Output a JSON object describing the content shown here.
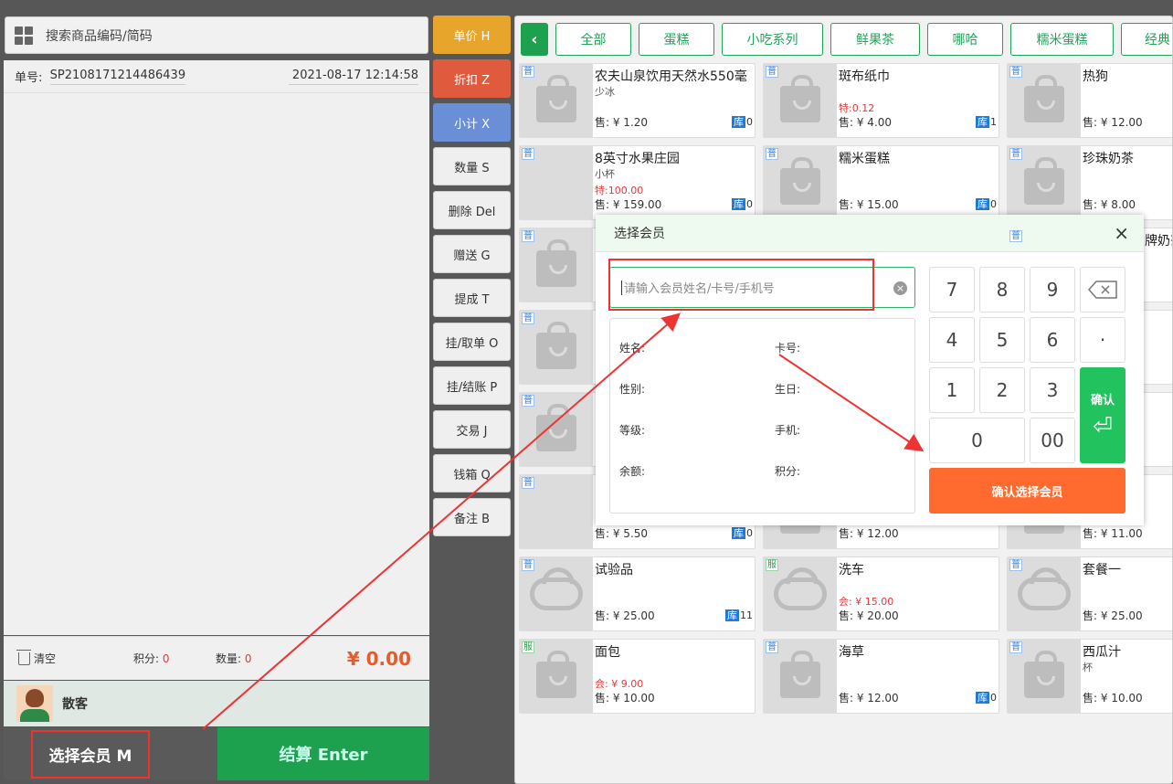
{
  "search": {
    "placeholder": "搜索商品编码/简码"
  },
  "order": {
    "no_label": "单号:",
    "no": "SP2108171214486439",
    "datetime": "2021-08-17 12:14:58"
  },
  "summary": {
    "clear": "清空",
    "points_label": "积分:",
    "points": "0",
    "qty_label": "数量:",
    "qty": "0",
    "total": "¥ 0.00"
  },
  "member": {
    "name": "散客"
  },
  "buttons": {
    "select_member": "选择会员 M",
    "checkout": "结算 Enter"
  },
  "functions": [
    "单价 H",
    "折扣 Z",
    "小计 X",
    "数量 S",
    "删除 Del",
    "赠送 G",
    "提成 T",
    "挂/取单 O",
    "挂/结账 P",
    "交易 J",
    "钱箱 Q",
    "备注 B"
  ],
  "categories": [
    "全部",
    "蛋糕",
    "小吃系列",
    "鲜果茶",
    "哪哈",
    "糯米蛋糕",
    "经典"
  ],
  "products": [
    {
      "tag": "普",
      "name": "农夫山泉饮用天然水550毫",
      "sub": "少冰",
      "spec": "",
      "price": "售: ¥ 1.20",
      "stock": "0"
    },
    {
      "tag": "普",
      "name": "斑布纸巾",
      "sub": "",
      "spec": "特:0.12",
      "price": "售: ¥ 4.00",
      "stock": "1"
    },
    {
      "tag": "普",
      "name": "热狗",
      "sub": "",
      "spec": "",
      "price": "售: ¥ 12.00",
      "stock": ""
    },
    {
      "tag": "普",
      "name": "8英寸水果庄园",
      "sub": "小杯",
      "spec": "特:100.00",
      "price": "售: ¥ 159.00",
      "stock": "0"
    },
    {
      "tag": "普",
      "name": "糯米蛋糕",
      "sub": "",
      "spec": "",
      "price": "售: ¥ 15.00",
      "stock": "0"
    },
    {
      "tag": "普",
      "name": "珍珠奶茶",
      "sub": "",
      "spec": "",
      "price": "售: ¥ 8.00",
      "stock": ""
    },
    {
      "tag": "普",
      "name": "",
      "sub": "",
      "spec": "",
      "price": "售: ¥ 5.50",
      "stock": "0"
    },
    {
      "tag": "",
      "name": "",
      "sub": "",
      "spec": "",
      "price": "售: ¥ 12.00",
      "stock": ""
    },
    {
      "tag": "",
      "name": "",
      "sub": "",
      "spec": "",
      "price": "售: ¥ 11.00",
      "stock": ""
    },
    {
      "tag": "普",
      "name": "试验品",
      "sub": "",
      "spec": "",
      "price": "售: ¥ 25.00",
      "stock": "11"
    },
    {
      "tag": "服",
      "name": "洗车",
      "sub": "",
      "spec": "会: ¥ 15.00",
      "price": "售: ¥ 20.00",
      "stock": ""
    },
    {
      "tag": "普",
      "name": "套餐一",
      "sub": "",
      "spec": "",
      "price": "售: ¥ 25.00",
      "stock": ""
    },
    {
      "tag": "服",
      "name": "面包",
      "sub": "",
      "spec": "会: ¥ 9.00",
      "price": "售: ¥ 10.00",
      "stock": ""
    },
    {
      "tag": "普",
      "name": "海草",
      "sub": "",
      "spec": "",
      "price": "售: ¥ 12.00",
      "stock": "0"
    },
    {
      "tag": "普",
      "name": "西瓜汁",
      "sub": "杯",
      "spec": "",
      "price": "售: ¥ 10.00",
      "stock": ""
    }
  ],
  "partial_labels": {
    "row3_right": "牌奶茶",
    "stock_label": "库"
  },
  "modal": {
    "title": "选择会员",
    "close": "×",
    "input_placeholder": "请输入会员姓名/卡号/手机号",
    "fields": {
      "name": "姓名:",
      "card": "卡号:",
      "gender": "性别:",
      "birthday": "生日:",
      "level": "等级:",
      "phone": "手机:",
      "balance": "余额:",
      "points": "积分:"
    },
    "keys": [
      "7",
      "8",
      "9",
      "4",
      "5",
      "6",
      "·",
      "1",
      "2",
      "3",
      "0",
      "00"
    ],
    "confirm_key": "确认",
    "confirm_member": "确认选择会员"
  },
  "colors": {
    "accent": "#1ea14f",
    "orange": "#ff6a2e",
    "highlight": "#e33333"
  }
}
